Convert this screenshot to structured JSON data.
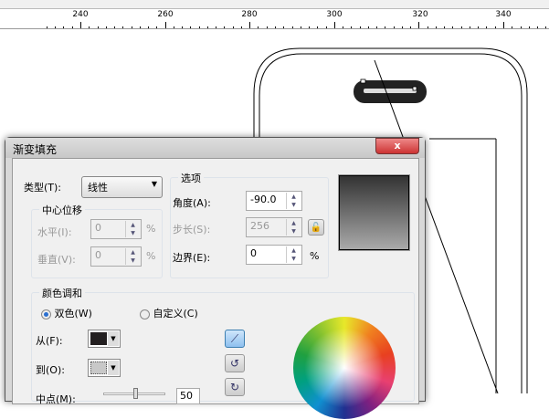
{
  "ruler": {
    "labels": [
      "240",
      "260",
      "280",
      "300",
      "320",
      "340"
    ]
  },
  "dialog": {
    "title": "渐变填充",
    "close_label": "x",
    "type_label": "类型(T):",
    "type_value": "线性",
    "center_offset": {
      "title": "中心位移",
      "horizontal_label": "水平(I):",
      "horizontal_value": "0",
      "vertical_label": "垂直(V):",
      "vertical_value": "0",
      "unit": "%"
    },
    "options": {
      "title": "选项",
      "angle_label": "角度(A):",
      "angle_value": "-90.0",
      "steps_label": "步长(S):",
      "steps_value": "256",
      "edge_label": "边界(E):",
      "edge_value": "0",
      "unit": "%"
    },
    "blend": {
      "title": "颜色调和",
      "two_color_label": "双色(W)",
      "custom_label": "自定义(C)",
      "from_label": "从(F):",
      "to_label": "到(O):",
      "midpoint_label": "中点(M):",
      "midpoint_value": "50",
      "from_color": "#231f20",
      "to_color": "#c8c8c8"
    }
  }
}
